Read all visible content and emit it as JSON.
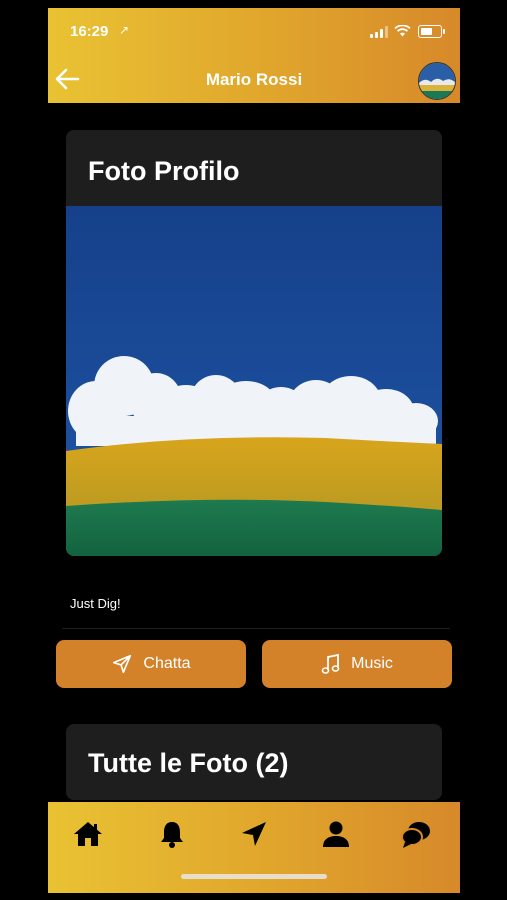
{
  "status_bar": {
    "time": "16:29",
    "location_arrow": "↗"
  },
  "header": {
    "title": "Mario Rossi",
    "back_icon": "back-arrow-icon",
    "avatar_icon": "profile-avatar"
  },
  "profile_card": {
    "title": "Foto Profilo"
  },
  "bio": {
    "text": "Just Dig!"
  },
  "actions": {
    "chat_label": "Chatta",
    "music_label": "Music"
  },
  "photos_card": {
    "title": "Tutte le Foto (2)"
  },
  "tab_bar": {
    "items": [
      "home-icon",
      "bell-icon",
      "navigation-icon",
      "person-icon",
      "chat-bubbles-icon"
    ]
  },
  "colors": {
    "gold_start": "#e9c233",
    "gold_end": "#d7892a",
    "button": "#d4822a",
    "card": "#1e1e1e"
  }
}
